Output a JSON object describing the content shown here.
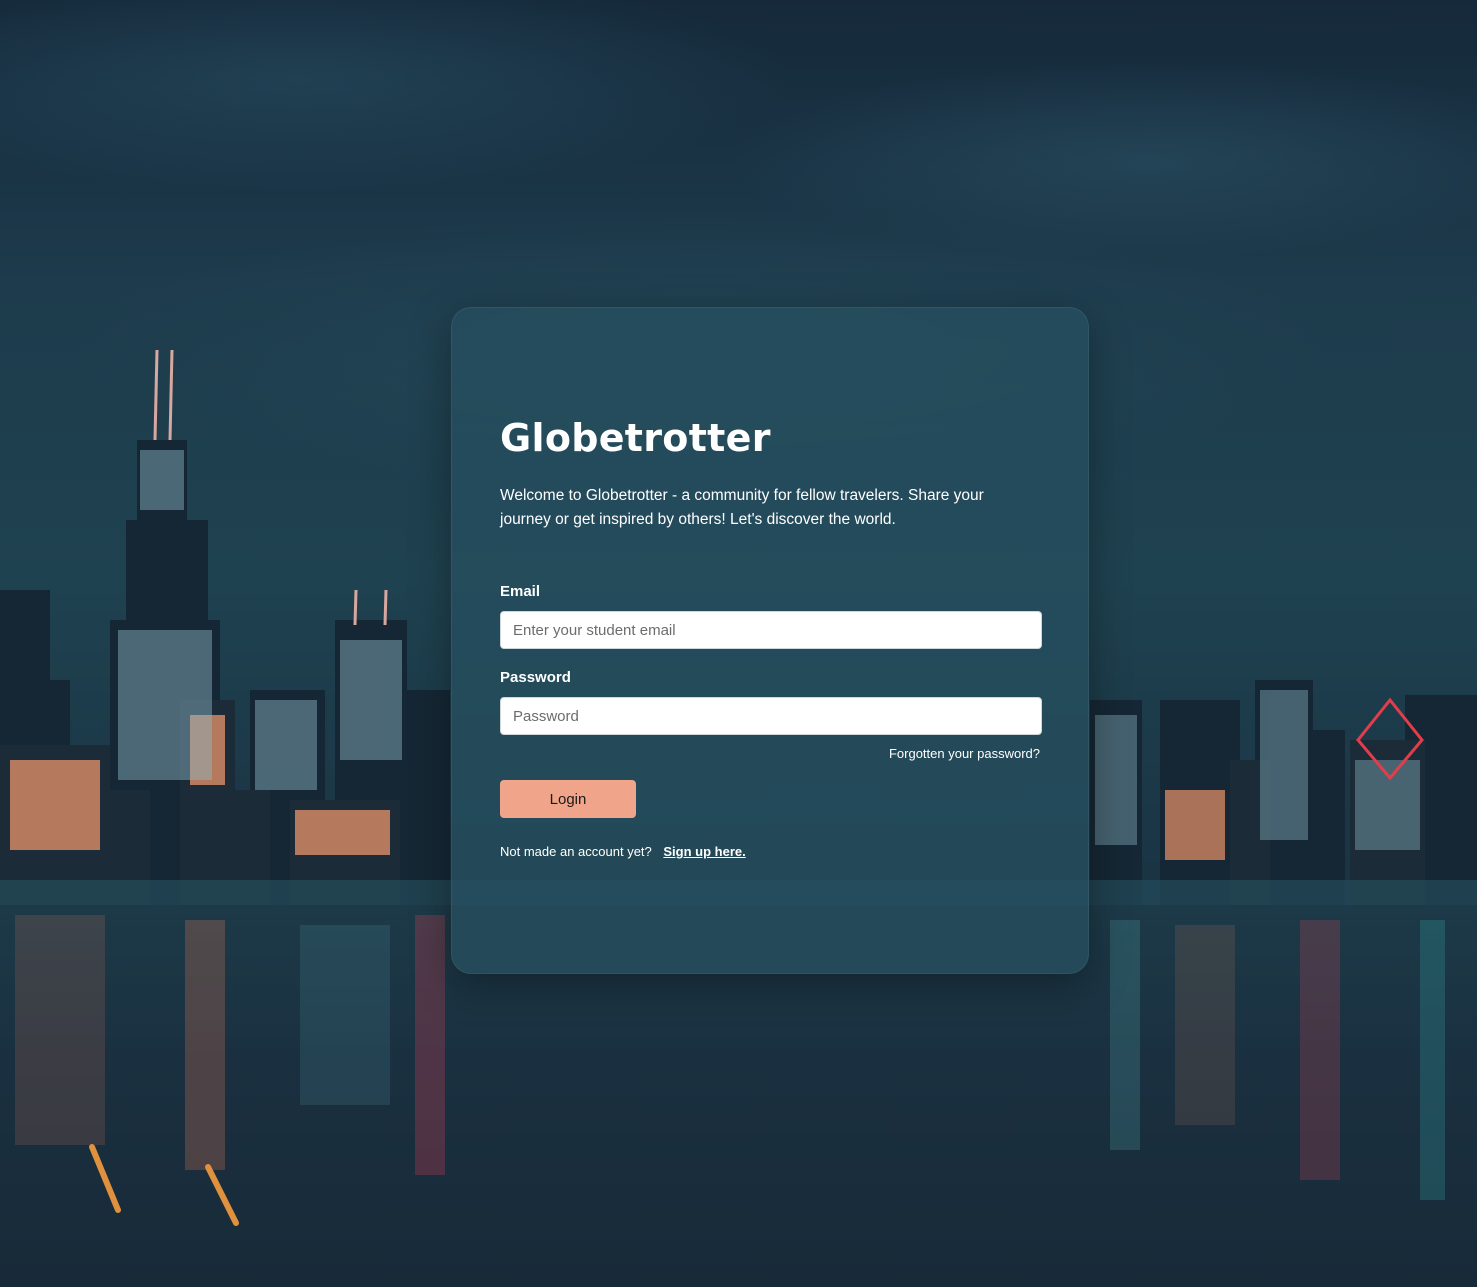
{
  "app": {
    "title": "Globetrotter",
    "intro": "Welcome to Globetrotter - a community for fellow travelers. Share your journey or get inspired by others! Let's discover the world."
  },
  "form": {
    "email_label": "Email",
    "email_placeholder": "Enter your student email",
    "email_value": "",
    "password_label": "Password",
    "password_placeholder": "Password",
    "password_value": "",
    "forgot_link": "Forgotten your password?",
    "login_button": "Login",
    "signup_prompt": "Not made an account yet?",
    "signup_link": "Sign up here."
  },
  "theme": {
    "accent": "#f0a58a",
    "card_bg": "#264e5e",
    "text": "#ffffff"
  }
}
